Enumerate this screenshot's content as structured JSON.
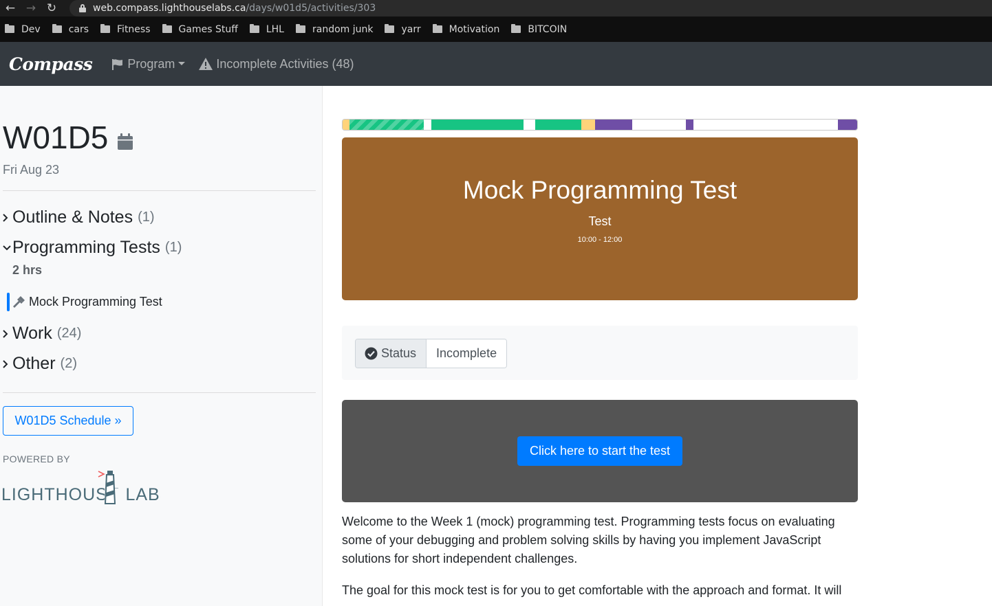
{
  "browser": {
    "url_host": "web.compass.lighthouselabs.ca",
    "url_path": "/days/w01d5/activities/303",
    "bookmarks": [
      "Dev",
      "cars",
      "Fitness",
      "Games Stuff",
      "LHL",
      "random junk",
      "yarr",
      "Motivation",
      "BITCOIN"
    ]
  },
  "nav": {
    "logo": "Compass",
    "program_label": "Program",
    "incomplete_label": "Incomplete Activities (48)"
  },
  "sidebar": {
    "day_title": "W01D5",
    "day_date": "Fri Aug 23",
    "sections": [
      {
        "title": "Outline & Notes",
        "count": "(1)"
      },
      {
        "title": "Programming Tests",
        "count": "(1)"
      },
      {
        "title": "Work",
        "count": "(24)"
      },
      {
        "title": "Other",
        "count": "(2)"
      }
    ],
    "duration": "2 hrs",
    "active_activity": "Mock Programming Test",
    "schedule_button": "W01D5 Schedule »",
    "powered_by": "POWERED BY",
    "brand_logo_text": "LIGHTHOUSE LABS"
  },
  "progress_segments": [
    {
      "color": "#ffd37a",
      "share": 1.3,
      "striped": false
    },
    {
      "color": "#17c483",
      "share": 14.5,
      "striped": true
    },
    {
      "color": "#ffffff",
      "share": 1.5,
      "striped": false
    },
    {
      "color": "#17c483",
      "share": 17.8,
      "striped": false
    },
    {
      "color": "#ffffff",
      "share": 2.4,
      "striped": false
    },
    {
      "color": "#17c483",
      "share": 8.9,
      "striped": false
    },
    {
      "color": "#ffd37a",
      "share": 2.7,
      "striped": false
    },
    {
      "color": "#6f4ea6",
      "share": 7.2,
      "striped": false
    },
    {
      "color": "#ffffff",
      "share": 10.4,
      "striped": false
    },
    {
      "color": "#6f4ea6",
      "share": 1.5,
      "striped": false
    },
    {
      "color": "#ffffff",
      "share": 28.0,
      "striped": false
    },
    {
      "color": "#6f4ea6",
      "share": 3.8,
      "striped": false
    }
  ],
  "activity": {
    "title": "Mock Programming Test",
    "type": "Test",
    "time": "10:00 - 12:00",
    "hero_color": "#9c642c",
    "status_label": "Status",
    "status_value": "Incomplete",
    "start_button": "Click here to start the test",
    "paragraph1": "Welcome to the Week 1 (mock) programming test. Programming tests focus on evaluating some of your debugging and problem solving skills by having you implement JavaScript solutions for short independent challenges.",
    "paragraph2": "The goal for this mock test is for you to get comfortable with the approach and format. It will"
  }
}
